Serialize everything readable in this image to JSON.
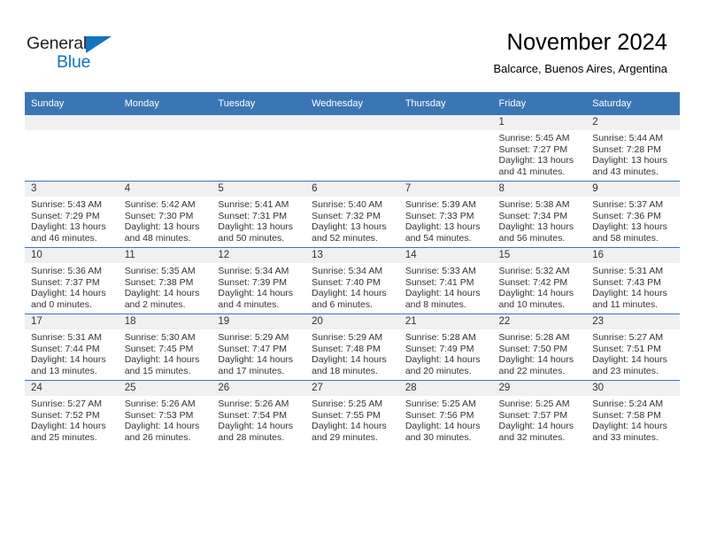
{
  "brand": {
    "name_part1": "General",
    "name_part2": "Blue",
    "accent_color": "#1474bc"
  },
  "header": {
    "title": "November 2024",
    "subtitle": "Balcarce, Buenos Aires, Argentina"
  },
  "theme": {
    "header_blue": "#3b76b4",
    "daynum_band": "#f0f0f0",
    "text": "#333333"
  },
  "weekdays": [
    "Sunday",
    "Monday",
    "Tuesday",
    "Wednesday",
    "Thursday",
    "Friday",
    "Saturday"
  ],
  "weeks": [
    [
      {
        "day": "",
        "empty": true
      },
      {
        "day": "",
        "empty": true
      },
      {
        "day": "",
        "empty": true
      },
      {
        "day": "",
        "empty": true
      },
      {
        "day": "",
        "empty": true
      },
      {
        "day": "1",
        "sunrise": "Sunrise: 5:45 AM",
        "sunset": "Sunset: 7:27 PM",
        "daylight_1": "Daylight: 13 hours",
        "daylight_2": "and 41 minutes."
      },
      {
        "day": "2",
        "sunrise": "Sunrise: 5:44 AM",
        "sunset": "Sunset: 7:28 PM",
        "daylight_1": "Daylight: 13 hours",
        "daylight_2": "and 43 minutes."
      }
    ],
    [
      {
        "day": "3",
        "sunrise": "Sunrise: 5:43 AM",
        "sunset": "Sunset: 7:29 PM",
        "daylight_1": "Daylight: 13 hours",
        "daylight_2": "and 46 minutes."
      },
      {
        "day": "4",
        "sunrise": "Sunrise: 5:42 AM",
        "sunset": "Sunset: 7:30 PM",
        "daylight_1": "Daylight: 13 hours",
        "daylight_2": "and 48 minutes."
      },
      {
        "day": "5",
        "sunrise": "Sunrise: 5:41 AM",
        "sunset": "Sunset: 7:31 PM",
        "daylight_1": "Daylight: 13 hours",
        "daylight_2": "and 50 minutes."
      },
      {
        "day": "6",
        "sunrise": "Sunrise: 5:40 AM",
        "sunset": "Sunset: 7:32 PM",
        "daylight_1": "Daylight: 13 hours",
        "daylight_2": "and 52 minutes."
      },
      {
        "day": "7",
        "sunrise": "Sunrise: 5:39 AM",
        "sunset": "Sunset: 7:33 PM",
        "daylight_1": "Daylight: 13 hours",
        "daylight_2": "and 54 minutes."
      },
      {
        "day": "8",
        "sunrise": "Sunrise: 5:38 AM",
        "sunset": "Sunset: 7:34 PM",
        "daylight_1": "Daylight: 13 hours",
        "daylight_2": "and 56 minutes."
      },
      {
        "day": "9",
        "sunrise": "Sunrise: 5:37 AM",
        "sunset": "Sunset: 7:36 PM",
        "daylight_1": "Daylight: 13 hours",
        "daylight_2": "and 58 minutes."
      }
    ],
    [
      {
        "day": "10",
        "sunrise": "Sunrise: 5:36 AM",
        "sunset": "Sunset: 7:37 PM",
        "daylight_1": "Daylight: 14 hours",
        "daylight_2": "and 0 minutes."
      },
      {
        "day": "11",
        "sunrise": "Sunrise: 5:35 AM",
        "sunset": "Sunset: 7:38 PM",
        "daylight_1": "Daylight: 14 hours",
        "daylight_2": "and 2 minutes."
      },
      {
        "day": "12",
        "sunrise": "Sunrise: 5:34 AM",
        "sunset": "Sunset: 7:39 PM",
        "daylight_1": "Daylight: 14 hours",
        "daylight_2": "and 4 minutes."
      },
      {
        "day": "13",
        "sunrise": "Sunrise: 5:34 AM",
        "sunset": "Sunset: 7:40 PM",
        "daylight_1": "Daylight: 14 hours",
        "daylight_2": "and 6 minutes."
      },
      {
        "day": "14",
        "sunrise": "Sunrise: 5:33 AM",
        "sunset": "Sunset: 7:41 PM",
        "daylight_1": "Daylight: 14 hours",
        "daylight_2": "and 8 minutes."
      },
      {
        "day": "15",
        "sunrise": "Sunrise: 5:32 AM",
        "sunset": "Sunset: 7:42 PM",
        "daylight_1": "Daylight: 14 hours",
        "daylight_2": "and 10 minutes."
      },
      {
        "day": "16",
        "sunrise": "Sunrise: 5:31 AM",
        "sunset": "Sunset: 7:43 PM",
        "daylight_1": "Daylight: 14 hours",
        "daylight_2": "and 11 minutes."
      }
    ],
    [
      {
        "day": "17",
        "sunrise": "Sunrise: 5:31 AM",
        "sunset": "Sunset: 7:44 PM",
        "daylight_1": "Daylight: 14 hours",
        "daylight_2": "and 13 minutes."
      },
      {
        "day": "18",
        "sunrise": "Sunrise: 5:30 AM",
        "sunset": "Sunset: 7:45 PM",
        "daylight_1": "Daylight: 14 hours",
        "daylight_2": "and 15 minutes."
      },
      {
        "day": "19",
        "sunrise": "Sunrise: 5:29 AM",
        "sunset": "Sunset: 7:47 PM",
        "daylight_1": "Daylight: 14 hours",
        "daylight_2": "and 17 minutes."
      },
      {
        "day": "20",
        "sunrise": "Sunrise: 5:29 AM",
        "sunset": "Sunset: 7:48 PM",
        "daylight_1": "Daylight: 14 hours",
        "daylight_2": "and 18 minutes."
      },
      {
        "day": "21",
        "sunrise": "Sunrise: 5:28 AM",
        "sunset": "Sunset: 7:49 PM",
        "daylight_1": "Daylight: 14 hours",
        "daylight_2": "and 20 minutes."
      },
      {
        "day": "22",
        "sunrise": "Sunrise: 5:28 AM",
        "sunset": "Sunset: 7:50 PM",
        "daylight_1": "Daylight: 14 hours",
        "daylight_2": "and 22 minutes."
      },
      {
        "day": "23",
        "sunrise": "Sunrise: 5:27 AM",
        "sunset": "Sunset: 7:51 PM",
        "daylight_1": "Daylight: 14 hours",
        "daylight_2": "and 23 minutes."
      }
    ],
    [
      {
        "day": "24",
        "sunrise": "Sunrise: 5:27 AM",
        "sunset": "Sunset: 7:52 PM",
        "daylight_1": "Daylight: 14 hours",
        "daylight_2": "and 25 minutes."
      },
      {
        "day": "25",
        "sunrise": "Sunrise: 5:26 AM",
        "sunset": "Sunset: 7:53 PM",
        "daylight_1": "Daylight: 14 hours",
        "daylight_2": "and 26 minutes."
      },
      {
        "day": "26",
        "sunrise": "Sunrise: 5:26 AM",
        "sunset": "Sunset: 7:54 PM",
        "daylight_1": "Daylight: 14 hours",
        "daylight_2": "and 28 minutes."
      },
      {
        "day": "27",
        "sunrise": "Sunrise: 5:25 AM",
        "sunset": "Sunset: 7:55 PM",
        "daylight_1": "Daylight: 14 hours",
        "daylight_2": "and 29 minutes."
      },
      {
        "day": "28",
        "sunrise": "Sunrise: 5:25 AM",
        "sunset": "Sunset: 7:56 PM",
        "daylight_1": "Daylight: 14 hours",
        "daylight_2": "and 30 minutes."
      },
      {
        "day": "29",
        "sunrise": "Sunrise: 5:25 AM",
        "sunset": "Sunset: 7:57 PM",
        "daylight_1": "Daylight: 14 hours",
        "daylight_2": "and 32 minutes."
      },
      {
        "day": "30",
        "sunrise": "Sunrise: 5:24 AM",
        "sunset": "Sunset: 7:58 PM",
        "daylight_1": "Daylight: 14 hours",
        "daylight_2": "and 33 minutes."
      }
    ]
  ]
}
